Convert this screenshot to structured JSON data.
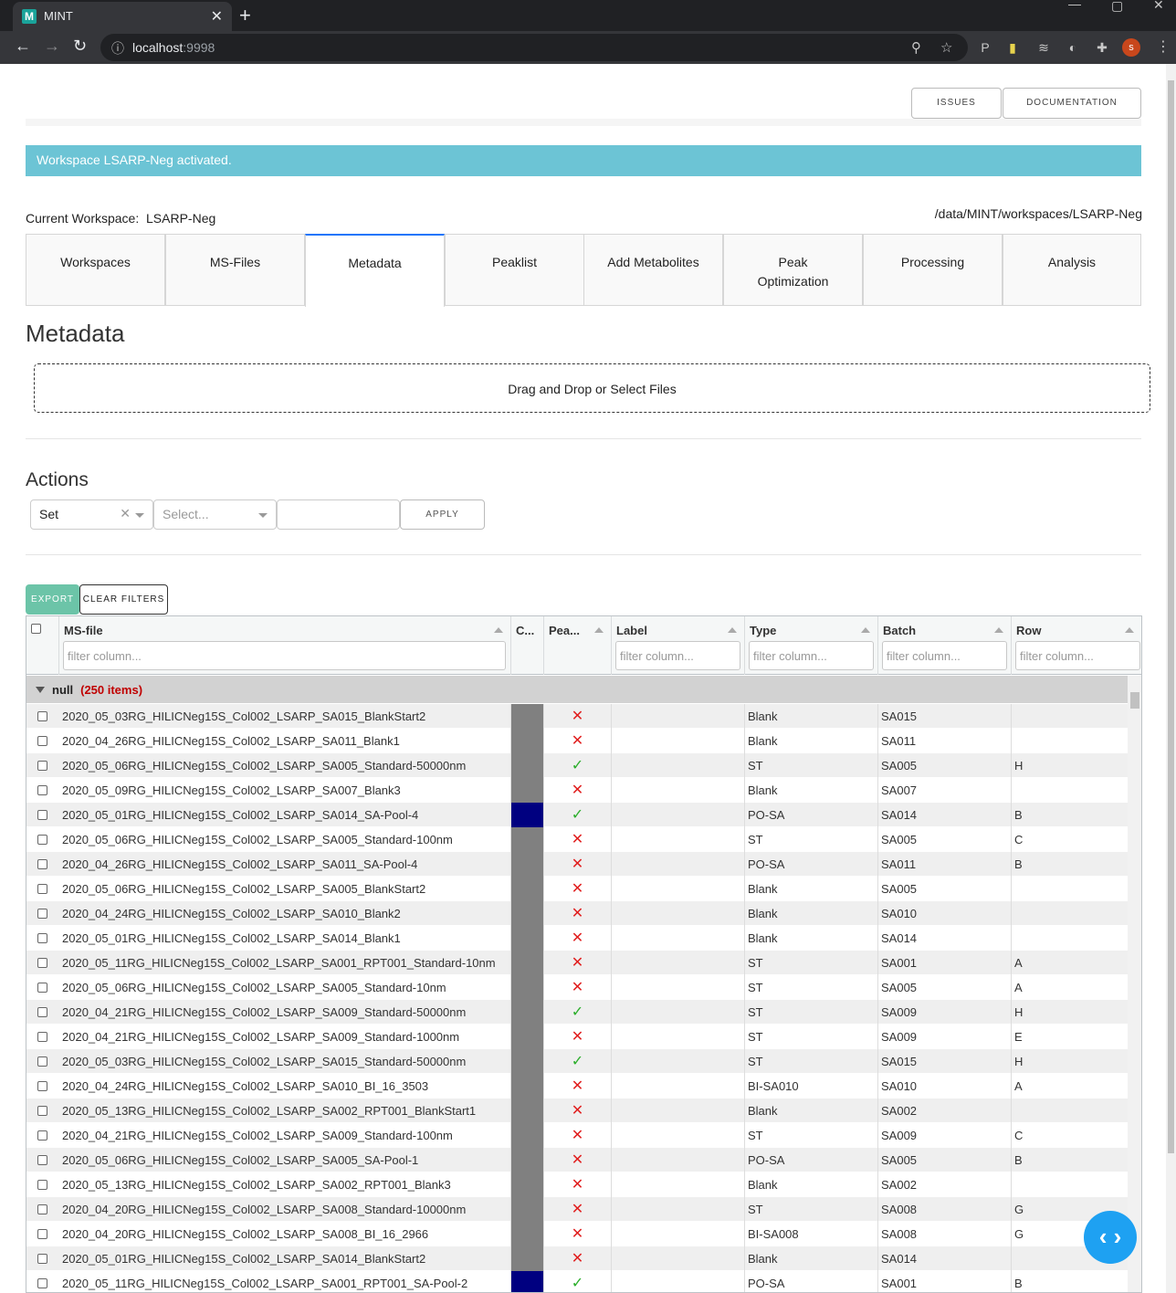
{
  "browser": {
    "tab_title": "MINT",
    "favicon_letter": "M",
    "url_host": "localhost",
    "url_port": ":9998",
    "avatar_letter": "s"
  },
  "header": {
    "issues_label": "ISSUES",
    "documentation_label": "DOCUMENTATION"
  },
  "alert": {
    "text": "Workspace LSARP-Neg activated."
  },
  "workspace": {
    "current_label": "Current Workspace:",
    "current_name": "LSARP-Neg",
    "path": "/data/MINT/workspaces/LSARP-Neg"
  },
  "tabs": [
    {
      "label": "Workspaces"
    },
    {
      "label": "MS-Files"
    },
    {
      "label": "Metadata"
    },
    {
      "label": "Peaklist"
    },
    {
      "label": "Add Metabolites"
    },
    {
      "label": "Peak Optimization"
    },
    {
      "label": "Processing"
    },
    {
      "label": "Analysis"
    }
  ],
  "metadata": {
    "title": "Metadata",
    "dropzone_text": "Drag and Drop or Select Files"
  },
  "actions": {
    "title": "Actions",
    "action_value": "Set",
    "column_placeholder": "Select...",
    "apply_label": "APPLY"
  },
  "table_buttons": {
    "export_label": "EXPORT",
    "clear_filters_label": "CLEAR FILTERS"
  },
  "table": {
    "columns": {
      "msfile": "MS-file",
      "color": "C...",
      "peak": "Pea...",
      "label": "Label",
      "type": "Type",
      "batch": "Batch",
      "row": "Row"
    },
    "filter_placeholder": "filter column...",
    "group": {
      "name": "null",
      "count": "(250 items)"
    },
    "rows": [
      {
        "file": "2020_05_03RG_HILICNeg15S_Col002_LSARP_SA015_BlankStart2",
        "color": "#808080",
        "peak": "x",
        "label": "",
        "type": "Blank",
        "batch": "SA015",
        "row": ""
      },
      {
        "file": "2020_04_26RG_HILICNeg15S_Col002_LSARP_SA011_Blank1",
        "color": "#808080",
        "peak": "x",
        "label": "",
        "type": "Blank",
        "batch": "SA011",
        "row": ""
      },
      {
        "file": "2020_05_06RG_HILICNeg15S_Col002_LSARP_SA005_Standard-50000nm",
        "color": "#808080",
        "peak": "ok",
        "label": "",
        "type": "ST",
        "batch": "SA005",
        "row": "H"
      },
      {
        "file": "2020_05_09RG_HILICNeg15S_Col002_LSARP_SA007_Blank3",
        "color": "#808080",
        "peak": "x",
        "label": "",
        "type": "Blank",
        "batch": "SA007",
        "row": ""
      },
      {
        "file": "2020_05_01RG_HILICNeg15S_Col002_LSARP_SA014_SA-Pool-4",
        "color": "#000080",
        "peak": "ok",
        "label": "",
        "type": "PO-SA",
        "batch": "SA014",
        "row": "B"
      },
      {
        "file": "2020_05_06RG_HILICNeg15S_Col002_LSARP_SA005_Standard-100nm",
        "color": "#808080",
        "peak": "x",
        "label": "",
        "type": "ST",
        "batch": "SA005",
        "row": "C"
      },
      {
        "file": "2020_04_26RG_HILICNeg15S_Col002_LSARP_SA011_SA-Pool-4",
        "color": "#808080",
        "peak": "x",
        "label": "",
        "type": "PO-SA",
        "batch": "SA011",
        "row": "B"
      },
      {
        "file": "2020_05_06RG_HILICNeg15S_Col002_LSARP_SA005_BlankStart2",
        "color": "#808080",
        "peak": "x",
        "label": "",
        "type": "Blank",
        "batch": "SA005",
        "row": ""
      },
      {
        "file": "2020_04_24RG_HILICNeg15S_Col002_LSARP_SA010_Blank2",
        "color": "#808080",
        "peak": "x",
        "label": "",
        "type": "Blank",
        "batch": "SA010",
        "row": ""
      },
      {
        "file": "2020_05_01RG_HILICNeg15S_Col002_LSARP_SA014_Blank1",
        "color": "#808080",
        "peak": "x",
        "label": "",
        "type": "Blank",
        "batch": "SA014",
        "row": ""
      },
      {
        "file": "2020_05_11RG_HILICNeg15S_Col002_LSARP_SA001_RPT001_Standard-10nm",
        "color": "#808080",
        "peak": "x",
        "label": "",
        "type": "ST",
        "batch": "SA001",
        "row": "A"
      },
      {
        "file": "2020_05_06RG_HILICNeg15S_Col002_LSARP_SA005_Standard-10nm",
        "color": "#808080",
        "peak": "x",
        "label": "",
        "type": "ST",
        "batch": "SA005",
        "row": "A"
      },
      {
        "file": "2020_04_21RG_HILICNeg15S_Col002_LSARP_SA009_Standard-50000nm",
        "color": "#808080",
        "peak": "ok",
        "label": "",
        "type": "ST",
        "batch": "SA009",
        "row": "H"
      },
      {
        "file": "2020_04_21RG_HILICNeg15S_Col002_LSARP_SA009_Standard-1000nm",
        "color": "#808080",
        "peak": "x",
        "label": "",
        "type": "ST",
        "batch": "SA009",
        "row": "E"
      },
      {
        "file": "2020_05_03RG_HILICNeg15S_Col002_LSARP_SA015_Standard-50000nm",
        "color": "#808080",
        "peak": "ok",
        "label": "",
        "type": "ST",
        "batch": "SA015",
        "row": "H"
      },
      {
        "file": "2020_04_24RG_HILICNeg15S_Col002_LSARP_SA010_BI_16_3503",
        "color": "#808080",
        "peak": "x",
        "label": "",
        "type": "BI-SA010",
        "batch": "SA010",
        "row": "A"
      },
      {
        "file": "2020_05_13RG_HILICNeg15S_Col002_LSARP_SA002_RPT001_BlankStart1",
        "color": "#808080",
        "peak": "x",
        "label": "",
        "type": "Blank",
        "batch": "SA002",
        "row": ""
      },
      {
        "file": "2020_04_21RG_HILICNeg15S_Col002_LSARP_SA009_Standard-100nm",
        "color": "#808080",
        "peak": "x",
        "label": "",
        "type": "ST",
        "batch": "SA009",
        "row": "C"
      },
      {
        "file": "2020_05_06RG_HILICNeg15S_Col002_LSARP_SA005_SA-Pool-1",
        "color": "#808080",
        "peak": "x",
        "label": "",
        "type": "PO-SA",
        "batch": "SA005",
        "row": "B"
      },
      {
        "file": "2020_05_13RG_HILICNeg15S_Col002_LSARP_SA002_RPT001_Blank3",
        "color": "#808080",
        "peak": "x",
        "label": "",
        "type": "Blank",
        "batch": "SA002",
        "row": ""
      },
      {
        "file": "2020_04_20RG_HILICNeg15S_Col002_LSARP_SA008_Standard-10000nm",
        "color": "#808080",
        "peak": "x",
        "label": "",
        "type": "ST",
        "batch": "SA008",
        "row": "G"
      },
      {
        "file": "2020_04_20RG_HILICNeg15S_Col002_LSARP_SA008_BI_16_2966",
        "color": "#808080",
        "peak": "x",
        "label": "",
        "type": "BI-SA008",
        "batch": "SA008",
        "row": "G"
      },
      {
        "file": "2020_05_01RG_HILICNeg15S_Col002_LSARP_SA014_BlankStart2",
        "color": "#808080",
        "peak": "x",
        "label": "",
        "type": "Blank",
        "batch": "SA014",
        "row": ""
      },
      {
        "file": "2020_05_11RG_HILICNeg15S_Col002_LSARP_SA001_RPT001_SA-Pool-2",
        "color": "#000080",
        "peak": "ok",
        "label": "",
        "type": "PO-SA",
        "batch": "SA001",
        "row": "B"
      }
    ]
  },
  "colors": {
    "alert_bg": "#6cc4d5",
    "export_bg": "#6cc4a8",
    "active_tab_accent": "#1975fa",
    "fab_bg": "#1ea1f2",
    "x_mark": "#e11f1f",
    "ok_mark": "#2aae2a"
  },
  "icons": {
    "x_mark": "✕",
    "ok_mark": "✓",
    "fab": "‹ ›"
  }
}
